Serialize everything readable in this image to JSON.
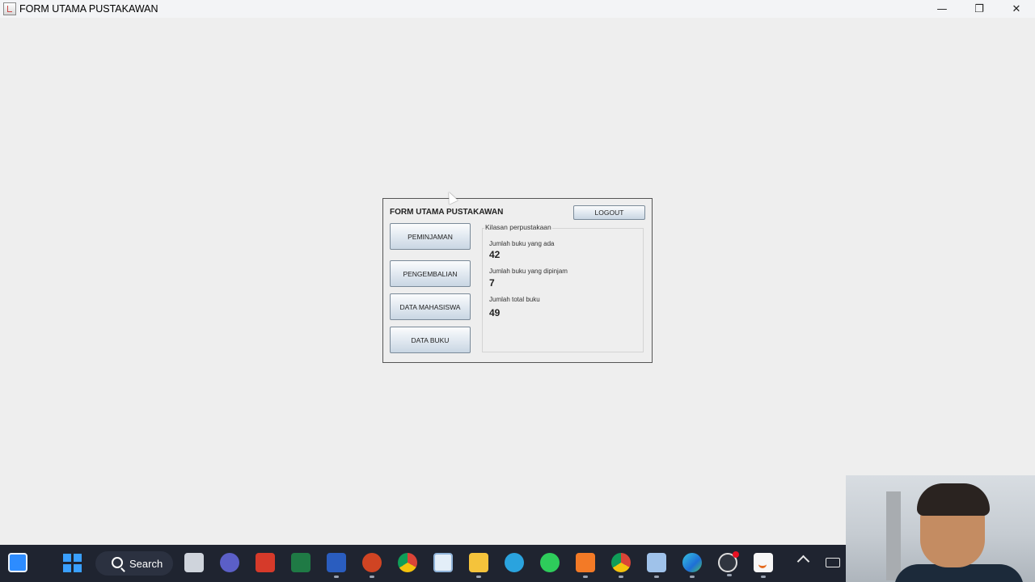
{
  "window": {
    "title": "FORM UTAMA PUSTAKAWAN",
    "minimize_glyph": "—",
    "maximize_glyph": "❐",
    "close_glyph": "✕"
  },
  "form": {
    "title": "FORM UTAMA PUSTAKAWAN",
    "logout_label": "LOGOUT",
    "menu": {
      "peminjaman": "PEMINJAMAN",
      "pengembalian": "PENGEMBALIAN",
      "data_mahasiswa": "DATA MAHASISWA",
      "data_buku": "DATA BUKU"
    },
    "summary": {
      "legend": "Kilasan perpustakaan",
      "available_label": "Jumlah buku yang ada",
      "available_value": "42",
      "borrowed_label": "Jumlah buku yang dipinjam",
      "borrowed_value": "7",
      "total_label": "Jumlah total buku",
      "total_value": "49"
    }
  },
  "taskbar": {
    "search_label": "Search",
    "icons": [
      "widgets-icon",
      "start-icon",
      "task-view-icon",
      "meeting-app-icon",
      "power-app-icon",
      "excel-icon",
      "word-icon",
      "powerpoint-icon",
      "chrome-icon",
      "monitor-app-icon",
      "file-explorer-icon",
      "telegram-icon",
      "whatsapp-icon",
      "xampp-icon",
      "chrome-icon",
      "box-app-icon",
      "edge-icon",
      "obs-icon",
      "java-icon"
    ]
  },
  "colors": {
    "window_bg": "#eeeeee",
    "button_gradient_bottom": "#c9d6e3",
    "taskbar_bg": "#1f2430"
  }
}
